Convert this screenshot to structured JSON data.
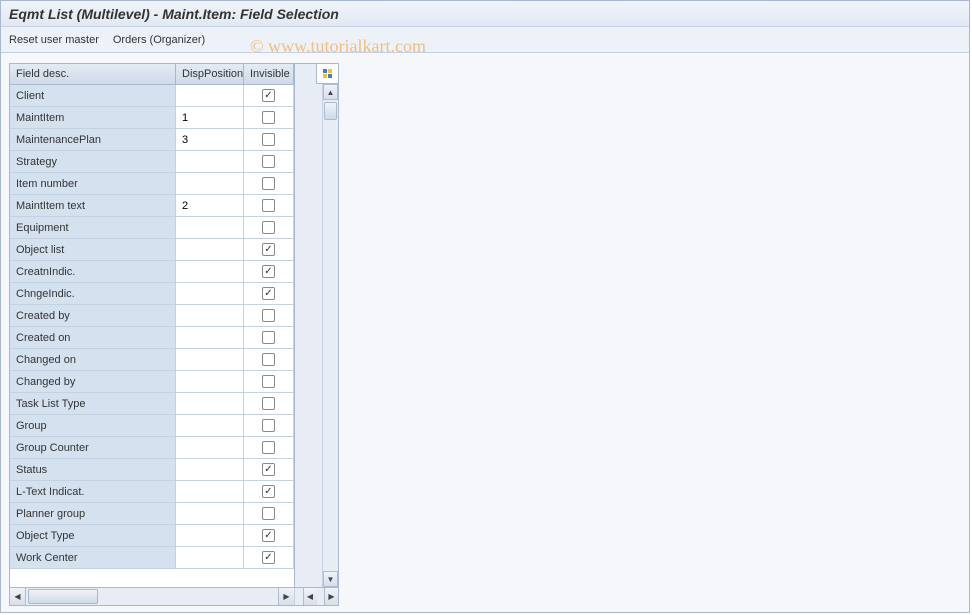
{
  "title": "Eqmt List (Multilevel) - Maint.Item: Field Selection",
  "toolbar": {
    "reset": "Reset user master",
    "orders": "Orders (Organizer)"
  },
  "watermark": "© www.tutorialkart.com",
  "columns": {
    "field_desc": "Field desc.",
    "disp_position": "DispPosition",
    "invisible": "Invisible"
  },
  "rows": [
    {
      "label": "Client",
      "pos": "",
      "inv": true
    },
    {
      "label": "MaintItem",
      "pos": "1",
      "inv": false
    },
    {
      "label": "MaintenancePlan",
      "pos": "3",
      "inv": false
    },
    {
      "label": "Strategy",
      "pos": "",
      "inv": false
    },
    {
      "label": "Item number",
      "pos": "",
      "inv": false
    },
    {
      "label": "MaintItem text",
      "pos": "2",
      "inv": false
    },
    {
      "label": "Equipment",
      "pos": "",
      "inv": false
    },
    {
      "label": "Object list",
      "pos": "",
      "inv": true
    },
    {
      "label": "CreatnIndic.",
      "pos": "",
      "inv": true
    },
    {
      "label": "ChngeIndic.",
      "pos": "",
      "inv": true
    },
    {
      "label": "Created by",
      "pos": "",
      "inv": false
    },
    {
      "label": "Created on",
      "pos": "",
      "inv": false
    },
    {
      "label": "Changed on",
      "pos": "",
      "inv": false
    },
    {
      "label": "Changed by",
      "pos": "",
      "inv": false
    },
    {
      "label": "Task List Type",
      "pos": "",
      "inv": false
    },
    {
      "label": "Group",
      "pos": "",
      "inv": false
    },
    {
      "label": "Group Counter",
      "pos": "",
      "inv": false
    },
    {
      "label": "Status",
      "pos": "",
      "inv": true
    },
    {
      "label": "L-Text Indicat.",
      "pos": "",
      "inv": true
    },
    {
      "label": "Planner group",
      "pos": "",
      "inv": false
    },
    {
      "label": "Object Type",
      "pos": "",
      "inv": true
    },
    {
      "label": "Work Center",
      "pos": "",
      "inv": true
    }
  ]
}
